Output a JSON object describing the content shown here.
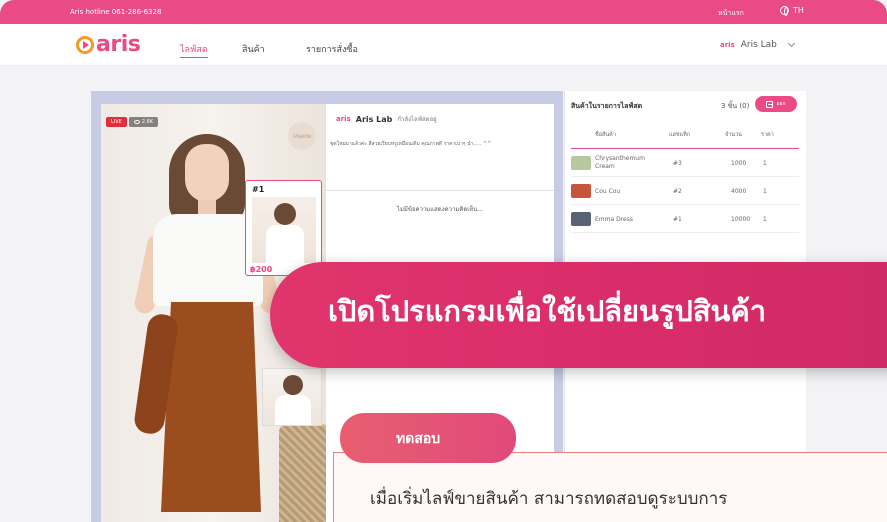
{
  "topbar": {
    "hotline": "Aris hotline 061-286-6328",
    "login": "หน้าแรก",
    "language": "TH"
  },
  "nav": {
    "logo": "aris",
    "items": [
      {
        "label": "ไลฟ์สด",
        "active": true
      },
      {
        "label": "สินค้า",
        "active": false
      },
      {
        "label": "รายการสั่งซื้อ",
        "active": false
      }
    ],
    "user": {
      "brand": "aris",
      "name": "Aris Lab"
    }
  },
  "live": {
    "badge": "LIVE",
    "views": "2.6K",
    "product_badge": "FASHION"
  },
  "pinned": {
    "number": "#1",
    "price": "฿200"
  },
  "chat": {
    "brand": "aris",
    "shop": "Aris Lab",
    "status": "กำลังไลฟ์สดอยู่",
    "description": "ชุดใหม่มาแล้วค่ะ สีสวยเรียบหรูเหมือนเดิม คุณภาพดี ราคาเบาๆ นำ..... ^^",
    "empty": "ไม่มีข้อความแสดงความคิดเห็น..."
  },
  "panel": {
    "title": "สินค้าในรายการไลฟ์สด",
    "count": "3 ชิ้น (0)",
    "out_button": "ออก",
    "headers": [
      "ชื่อสินค้า",
      "แฮชแท็ก",
      "จำนวน",
      "ราคา"
    ],
    "rows": [
      {
        "name": "Chrysanthemum Cream",
        "pin": "#3",
        "qty": "1000",
        "price": "1",
        "color": "#b8c7a0"
      },
      {
        "name": "Cou Cou",
        "pin": "#2",
        "qty": "4000",
        "price": "1",
        "color": "#c7553b"
      },
      {
        "name": "Emma Dress",
        "pin": "#1",
        "qty": "10000",
        "price": "1",
        "color": "#5a6276"
      }
    ]
  },
  "banner": {
    "text": "เปิดโปรแกรมเพื่อใช้เปลี่ยนรูปสินค้า"
  },
  "tip": {
    "tag": "ทดสอบ",
    "text": "เมื่อเริ่มไลฟ์ขายสินค้า สามารถทดสอบดูระบบการ"
  }
}
